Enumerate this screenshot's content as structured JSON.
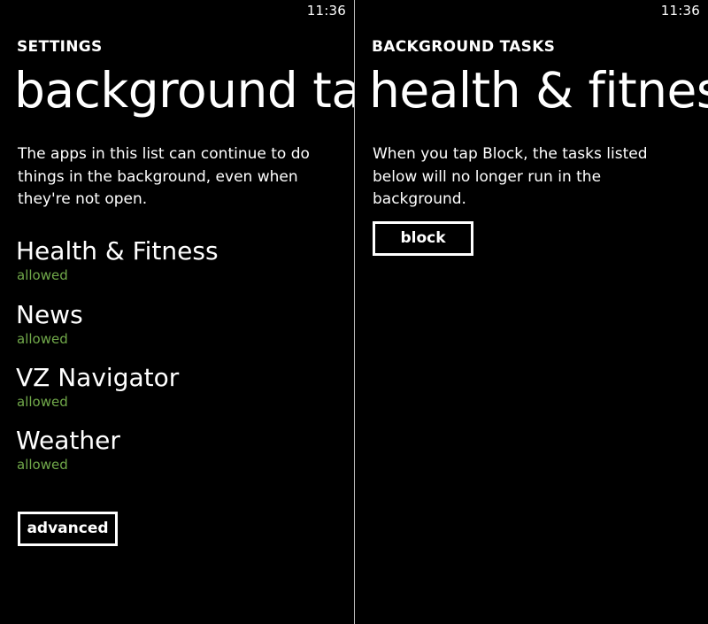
{
  "left_screen": {
    "status_time": "11:36",
    "app_title": "SETTINGS",
    "page_title": "background tasks",
    "description": "The apps in this list can continue to do things in the background, even when they're not open.",
    "apps": [
      {
        "name": "Health & Fitness",
        "status": "allowed"
      },
      {
        "name": "News",
        "status": "allowed"
      },
      {
        "name": "VZ Navigator",
        "status": "allowed"
      },
      {
        "name": "Weather",
        "status": "allowed"
      }
    ],
    "advanced_label": "advanced"
  },
  "right_screen": {
    "status_time": "11:36",
    "app_title": "BACKGROUND TASKS",
    "page_title": "health & fitness",
    "description": "When you tap Block, the tasks listed below will no longer run in the background.",
    "block_label": "block"
  },
  "colors": {
    "background": "#000000",
    "text": "#ffffff",
    "accent_status": "#71a94a",
    "divider": "#bdbdbd"
  }
}
